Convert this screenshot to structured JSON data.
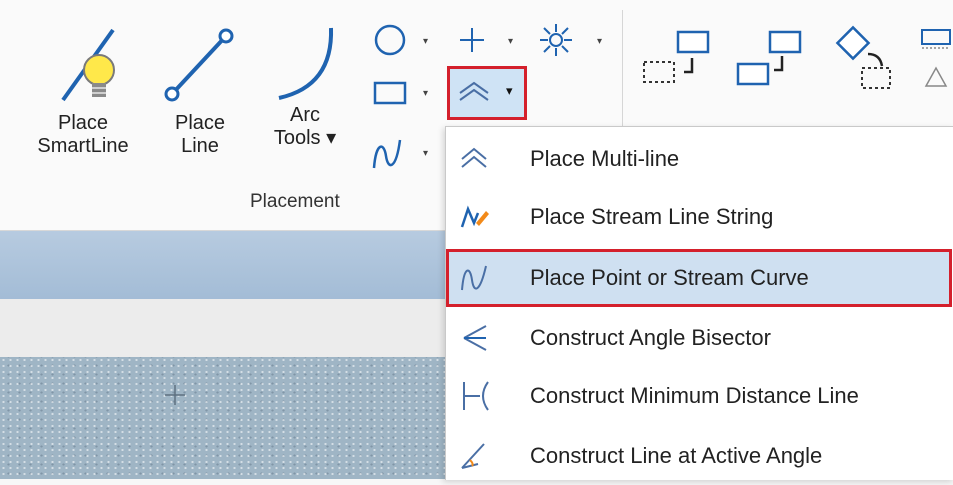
{
  "ribbon": {
    "tools": [
      {
        "label1": "Place",
        "label2": "SmartLine"
      },
      {
        "label1": "Place",
        "label2": "Line"
      },
      {
        "label1": "Arc",
        "label2": "Tools ▾"
      }
    ],
    "group_label": "Placement",
    "dropdown_arrow": "▾"
  },
  "menu": {
    "items": [
      {
        "label": "Place Multi-line",
        "icon": "multi-line-icon"
      },
      {
        "label": "Place Stream Line String",
        "icon": "stream-line-string-icon"
      },
      {
        "label": "Place Point or Stream Curve",
        "icon": "stream-curve-icon",
        "selected": true
      },
      {
        "label": "Construct Angle Bisector",
        "icon": "angle-bisector-icon"
      },
      {
        "label": "Construct Minimum Distance Line",
        "icon": "minimum-distance-icon"
      },
      {
        "label": "Construct Line at Active Angle",
        "icon": "active-angle-line-icon"
      }
    ]
  },
  "colors": {
    "accent_red": "#d4202c",
    "selection": "#cfe0f1",
    "icon_blue": "#1f63b0"
  }
}
